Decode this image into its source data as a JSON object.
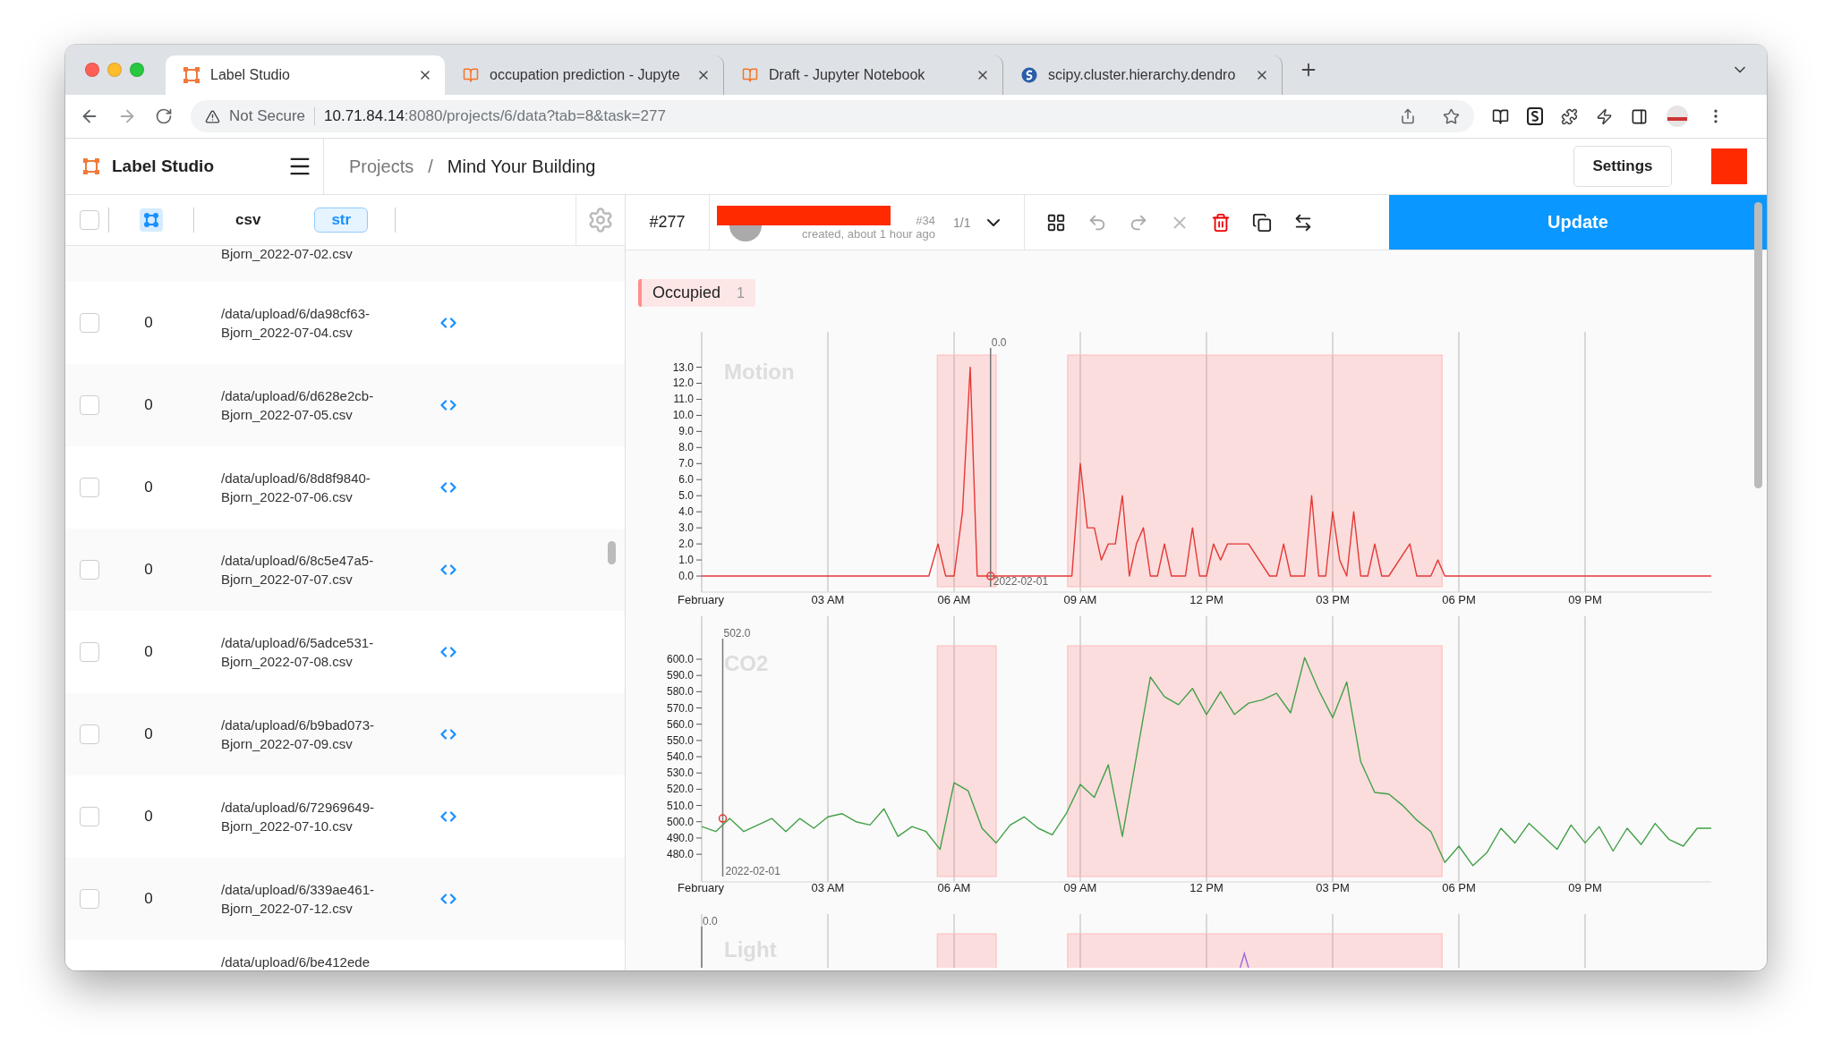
{
  "browser": {
    "tabs": [
      {
        "title": "Label Studio",
        "selected": true,
        "kind": "labelstudio"
      },
      {
        "title": "occupation prediction - Jupyte",
        "selected": false,
        "kind": "notebook"
      },
      {
        "title": "Draft - Jupyter Notebook",
        "selected": false,
        "kind": "notebook"
      },
      {
        "title": "scipy.cluster.hierarchy.dendro",
        "selected": false,
        "kind": "scipy"
      }
    ],
    "address": {
      "security": "Not Secure",
      "host": "10.71.84.14",
      "path": ":8080/projects/6/data?tab=8&task=277"
    }
  },
  "app_header": {
    "brand": "Label Studio",
    "breadcrumb": [
      "Projects",
      "Mind Your Building"
    ],
    "separator": "/",
    "settings": "Settings"
  },
  "data_panel": {
    "select_all": {
      "checked": false
    },
    "columns": [
      {
        "label": "csv",
        "kind": "plain"
      },
      {
        "label": "str",
        "kind": "tag"
      }
    ],
    "rows": [
      {
        "partial": true,
        "lines": [
          "Bjorn_2022-07-02.csv"
        ]
      },
      {
        "partial": false,
        "checked": false,
        "count": "0",
        "lines": [
          "/data/upload/6/da98cf63-",
          "Bjorn_2022-07-04.csv"
        ]
      },
      {
        "partial": false,
        "checked": false,
        "count": "0",
        "lines": [
          "/data/upload/6/d628e2cb-",
          "Bjorn_2022-07-05.csv"
        ]
      },
      {
        "partial": false,
        "checked": false,
        "count": "0",
        "lines": [
          "/data/upload/6/8d8f9840-",
          "Bjorn_2022-07-06.csv"
        ]
      },
      {
        "partial": false,
        "checked": false,
        "count": "0",
        "lines": [
          "/data/upload/6/8c5e47a5-",
          "Bjorn_2022-07-07.csv"
        ]
      },
      {
        "partial": false,
        "checked": false,
        "count": "0",
        "lines": [
          "/data/upload/6/5adce531-",
          "Bjorn_2022-07-08.csv"
        ]
      },
      {
        "partial": false,
        "checked": false,
        "count": "0",
        "lines": [
          "/data/upload/6/b9bad073-",
          "Bjorn_2022-07-09.csv"
        ]
      },
      {
        "partial": false,
        "checked": false,
        "count": "0",
        "lines": [
          "/data/upload/6/72969649-",
          "Bjorn_2022-07-10.csv"
        ]
      },
      {
        "partial": false,
        "checked": false,
        "count": "0",
        "lines": [
          "/data/upload/6/339ae461-",
          "Bjorn_2022-07-12.csv"
        ]
      },
      {
        "partial": true,
        "lines": [
          "/data/upload/6/be412ede"
        ]
      }
    ]
  },
  "task_toolbar": {
    "task_id": "#277",
    "annotation_id": "#34",
    "created": "created, about 1 hour ago",
    "pager": "1/1",
    "update": "Update"
  },
  "labels": [
    {
      "label": "Occupied",
      "count": "1"
    }
  ],
  "charts": [
    {
      "cursor": {
        "value": "0.0",
        "date": "2022-02-01"
      },
      "chart_data": {
        "type": "line",
        "title": "Motion",
        "grid": true,
        "xlim": [
          "2022-02-01T00:00",
          "2022-02-02T00:00"
        ],
        "ylim": [
          -1,
          15.2
        ],
        "ref_lines": [
          {
            "axis": "x",
            "value": "2022-02-01T06:52"
          }
        ],
        "xticks": [
          {
            "value": "2022-02-01T00:00",
            "label": "February"
          },
          {
            "value": "2022-02-01T03:00",
            "label": "03 AM"
          },
          {
            "value": "2022-02-01T06:00",
            "label": "06 AM"
          },
          {
            "value": "2022-02-01T09:00",
            "label": "09 AM"
          },
          {
            "value": "2022-02-01T12:00",
            "label": "12 PM"
          },
          {
            "value": "2022-02-01T15:00",
            "label": "03 PM"
          },
          {
            "value": "2022-02-01T18:00",
            "label": "06 PM"
          },
          {
            "value": "2022-02-01T21:00",
            "label": "09 PM"
          }
        ],
        "yticks": [
          {
            "value": 0,
            "label": "0.0"
          },
          {
            "value": 1,
            "label": "1.0"
          },
          {
            "value": 2,
            "label": "2.0"
          },
          {
            "value": 3,
            "label": "3.0"
          },
          {
            "value": 4,
            "label": "4.0"
          },
          {
            "value": 5,
            "label": "5.0"
          },
          {
            "value": 6,
            "label": "6.0"
          },
          {
            "value": 7,
            "label": "7.0"
          },
          {
            "value": 8,
            "label": "8.0"
          },
          {
            "value": 9,
            "label": "9.0"
          },
          {
            "value": 10,
            "label": "10.0"
          },
          {
            "value": 11,
            "label": "11.0"
          },
          {
            "value": 12,
            "label": "12.0"
          },
          {
            "value": 13,
            "label": "13.0"
          }
        ],
        "x": [
          "2022-02-01T00:00",
          "2022-02-01T05:24",
          "2022-02-01T05:37",
          "2022-02-01T05:48",
          "2022-02-01T06:00",
          "2022-02-01T06:12",
          "2022-02-01T06:23",
          "2022-02-01T06:33",
          "2022-02-01T08:48",
          "2022-02-01T09:00",
          "2022-02-01T09:10",
          "2022-02-01T09:20",
          "2022-02-01T09:30",
          "2022-02-01T09:40",
          "2022-02-01T09:50",
          "2022-02-01T10:00",
          "2022-02-01T10:10",
          "2022-02-01T10:20",
          "2022-02-01T10:30",
          "2022-02-01T10:40",
          "2022-02-01T10:50",
          "2022-02-01T11:00",
          "2022-02-01T11:10",
          "2022-02-01T11:30",
          "2022-02-01T11:40",
          "2022-02-01T11:50",
          "2022-02-01T12:00",
          "2022-02-01T12:10",
          "2022-02-01T12:20",
          "2022-02-01T12:30",
          "2022-02-01T12:50",
          "2022-02-01T13:00",
          "2022-02-01T13:30",
          "2022-02-01T13:40",
          "2022-02-01T13:50",
          "2022-02-01T14:00",
          "2022-02-01T14:20",
          "2022-02-01T14:30",
          "2022-02-01T14:40",
          "2022-02-01T14:50",
          "2022-02-01T15:00",
          "2022-02-01T15:10",
          "2022-02-01T15:20",
          "2022-02-01T15:30",
          "2022-02-01T15:40",
          "2022-02-01T15:50",
          "2022-02-01T16:00",
          "2022-02-01T16:10",
          "2022-02-01T16:20",
          "2022-02-01T16:50",
          "2022-02-01T17:00",
          "2022-02-01T17:20",
          "2022-02-01T17:30",
          "2022-02-01T17:40",
          "2022-02-02T00:00"
        ],
        "series": [
          {
            "color": "#e53935",
            "values": [
              0,
              0,
              2,
              0,
              0,
              4,
              13,
              0,
              0,
              7,
              3,
              3,
              1,
              2,
              2,
              5,
              0,
              2,
              3,
              0,
              0,
              2,
              0,
              0,
              3,
              0,
              0,
              2,
              1,
              2,
              2,
              2,
              0,
              0,
              2,
              0,
              0,
              5,
              0,
              0,
              4,
              1,
              0,
              4,
              0,
              0,
              2,
              0,
              0,
              2,
              0,
              0,
              1,
              0,
              0
            ]
          }
        ]
      }
    },
    {
      "cursor": {
        "value": "502.0",
        "date": "2022-02-01"
      },
      "chart_data": {
        "type": "line",
        "title": "CO2",
        "grid": true,
        "xlim": [
          "2022-02-01T00:00",
          "2022-02-02T00:00"
        ],
        "ylim": [
          463,
          626.4
        ],
        "ref_lines": [
          {
            "axis": "x",
            "value": "2022-02-01T00:30"
          }
        ],
        "xticks": [
          {
            "value": "2022-02-01T00:00",
            "label": "February"
          },
          {
            "value": "2022-02-01T03:00",
            "label": "03 AM"
          },
          {
            "value": "2022-02-01T06:00",
            "label": "06 AM"
          },
          {
            "value": "2022-02-01T09:00",
            "label": "09 AM"
          },
          {
            "value": "2022-02-01T12:00",
            "label": "12 PM"
          },
          {
            "value": "2022-02-01T15:00",
            "label": "03 PM"
          },
          {
            "value": "2022-02-01T18:00",
            "label": "06 PM"
          },
          {
            "value": "2022-02-01T21:00",
            "label": "09 PM"
          }
        ],
        "yticks": [
          {
            "value": 480,
            "label": "480.0"
          },
          {
            "value": 490,
            "label": "490.0"
          },
          {
            "value": 500,
            "label": "500.0"
          },
          {
            "value": 510,
            "label": "510.0"
          },
          {
            "value": 520,
            "label": "520.0"
          },
          {
            "value": 530,
            "label": "530.0"
          },
          {
            "value": 540,
            "label": "540.0"
          },
          {
            "value": 550,
            "label": "550.0"
          },
          {
            "value": 560,
            "label": "560.0"
          },
          {
            "value": 570,
            "label": "570.0"
          },
          {
            "value": 580,
            "label": "580.0"
          },
          {
            "value": 590,
            "label": "590.0"
          },
          {
            "value": 600,
            "label": "600.0"
          }
        ],
        "x": [
          "2022-02-01T00:00",
          "2022-02-01T00:20",
          "2022-02-01T00:40",
          "2022-02-01T01:00",
          "2022-02-01T01:20",
          "2022-02-01T01:40",
          "2022-02-01T02:00",
          "2022-02-01T02:20",
          "2022-02-01T02:40",
          "2022-02-01T03:00",
          "2022-02-01T03:20",
          "2022-02-01T03:40",
          "2022-02-01T04:00",
          "2022-02-01T04:20",
          "2022-02-01T04:40",
          "2022-02-01T05:00",
          "2022-02-01T05:20",
          "2022-02-01T05:40",
          "2022-02-01T06:00",
          "2022-02-01T06:20",
          "2022-02-01T06:40",
          "2022-02-01T07:00",
          "2022-02-01T07:20",
          "2022-02-01T07:40",
          "2022-02-01T08:00",
          "2022-02-01T08:20",
          "2022-02-01T08:40",
          "2022-02-01T09:00",
          "2022-02-01T09:20",
          "2022-02-01T09:40",
          "2022-02-01T10:00",
          "2022-02-01T10:20",
          "2022-02-01T10:40",
          "2022-02-01T11:00",
          "2022-02-01T11:20",
          "2022-02-01T11:40",
          "2022-02-01T12:00",
          "2022-02-01T12:20",
          "2022-02-01T12:40",
          "2022-02-01T13:00",
          "2022-02-01T13:20",
          "2022-02-01T13:40",
          "2022-02-01T14:00",
          "2022-02-01T14:20",
          "2022-02-01T14:40",
          "2022-02-01T15:00",
          "2022-02-01T15:20",
          "2022-02-01T15:40",
          "2022-02-01T16:00",
          "2022-02-01T16:20",
          "2022-02-01T16:40",
          "2022-02-01T17:00",
          "2022-02-01T17:20",
          "2022-02-01T17:40",
          "2022-02-01T18:00",
          "2022-02-01T18:20",
          "2022-02-01T18:40",
          "2022-02-01T19:00",
          "2022-02-01T19:20",
          "2022-02-01T19:40",
          "2022-02-01T20:00",
          "2022-02-01T20:20",
          "2022-02-01T20:40",
          "2022-02-01T21:00",
          "2022-02-01T21:20",
          "2022-02-01T21:40",
          "2022-02-01T22:00",
          "2022-02-01T22:20",
          "2022-02-01T22:40",
          "2022-02-01T23:00",
          "2022-02-01T23:20",
          "2022-02-01T23:40",
          "2022-02-02T00:00"
        ],
        "series": [
          {
            "color": "#43a047",
            "values": [
              497,
              494,
              502,
              494,
              498,
              502,
              494,
              502,
              496,
              503,
              505,
              500,
              498,
              508,
              491,
              497,
              494,
              483,
              524,
              519,
              496,
              487,
              498,
              503,
              496,
              492,
              505,
              523,
              515,
              535,
              491,
              540,
              589,
              577,
              572,
              582,
              566,
              580,
              566,
              573,
              575,
              579,
              567,
              601,
              581,
              564,
              586,
              537,
              518,
              517,
              510,
              501,
              494,
              475,
              485,
              473,
              481,
              496,
              487,
              499,
              491,
              483,
              498,
              487,
              497,
              482,
              496,
              486,
              499,
              489,
              485,
              496,
              496
            ]
          }
        ]
      }
    }
  ],
  "light_panel": {
    "title": "Light",
    "cursor_label": "0.0"
  }
}
